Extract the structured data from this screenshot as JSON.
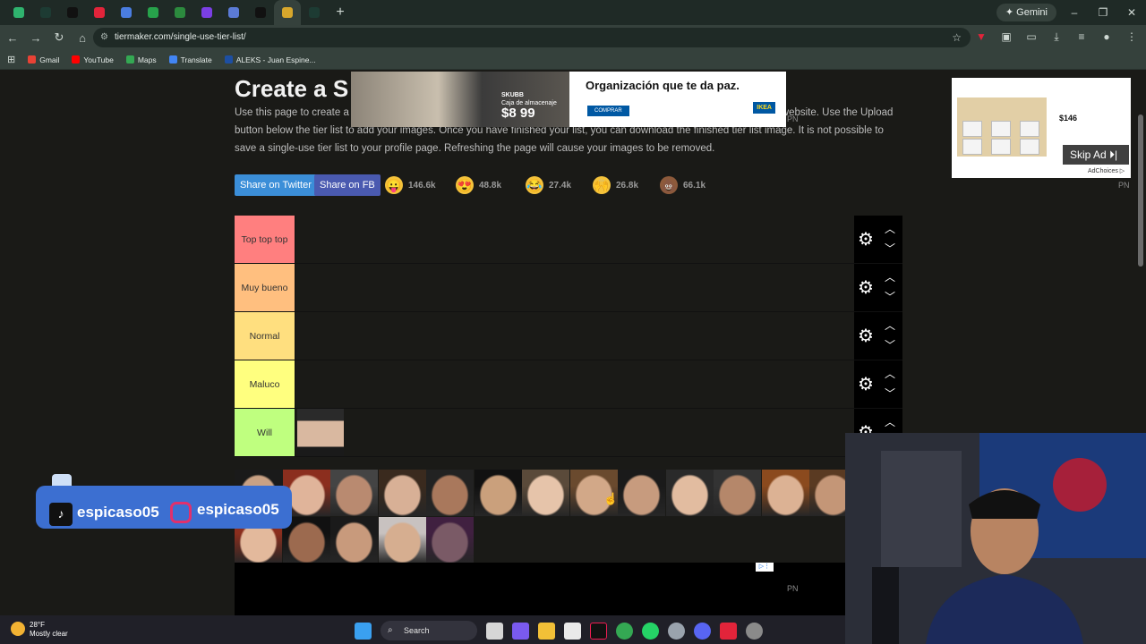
{
  "browser": {
    "tab_colors": [
      "#2fb36e",
      "#1d3b33",
      "#111111",
      "#e2243a",
      "#4a7de0",
      "#27a24b",
      "#2c8a3e",
      "#7b3fe4",
      "#5b7bd6",
      "#111111",
      "#d8a72c",
      "#1d3b33"
    ],
    "new_tab": "+",
    "gemini_label": "Gemini",
    "window_controls": [
      "–",
      "❐",
      "✕"
    ],
    "url": "tiermaker.com/single-use-tier-list/"
  },
  "bookmarks": [
    {
      "label": "Gmail",
      "color": "#e94235"
    },
    {
      "label": "YouTube",
      "color": "#ff0000"
    },
    {
      "label": "Maps",
      "color": "#34a853"
    },
    {
      "label": "Translate",
      "color": "#4285f4"
    },
    {
      "label": "ALEKS - Juan Espine...",
      "color": "#1d4fa3"
    }
  ],
  "page": {
    "title": "Create a S",
    "intro": "Use this page to create a single-use tier list. You can use images from your computer and they won't be uploaded to the website. Use the Upload button below the tier list to add your images. Once you have finished your list, you can download the finished tier list image. It is not possible to save a single-use tier list to your profile page. Refreshing the page will cause your images to be removed.",
    "share_twitter": "Share on Twitter",
    "share_fb": "Share on FB",
    "reactions": [
      {
        "emoji": "😛",
        "count": "146.6k",
        "color": "#f5c33b"
      },
      {
        "emoji": "😍",
        "count": "48.8k",
        "color": "#f5c33b"
      },
      {
        "emoji": "😂",
        "count": "27.4k",
        "color": "#f5c33b"
      },
      {
        "emoji": "🙌",
        "count": "26.8k",
        "color": "#f5c33b"
      },
      {
        "emoji": "💩",
        "count": "66.1k",
        "color": "#8d5a3b"
      }
    ],
    "pn": "PN"
  },
  "ad_top": {
    "product": "SKUBB",
    "product_desc": "Caja de almacenaje",
    "price": "$8 99",
    "headline": "Organización que te da paz.",
    "cta": "COMPRAR",
    "brand": "IKEA"
  },
  "side_ad": {
    "skip": "Skip Ad ⏵|",
    "adchoices": "AdChoices ▷",
    "price": "$146"
  },
  "tiers": [
    {
      "label": "Top top top",
      "color": "#ff7f7f"
    },
    {
      "label": "Muy bueno",
      "color": "#ffbf7f"
    },
    {
      "label": "Normal",
      "color": "#ffdf7f"
    },
    {
      "label": "Maluco",
      "color": "#ffff7f"
    },
    {
      "label": "Will",
      "color": "#bfff7f"
    }
  ],
  "social": {
    "tiktok_handle": "espicaso05",
    "instagram_handle": "espicaso05"
  },
  "taskbar": {
    "temp": "28°F",
    "condition": "Mostly clear",
    "search_label": "Search"
  }
}
